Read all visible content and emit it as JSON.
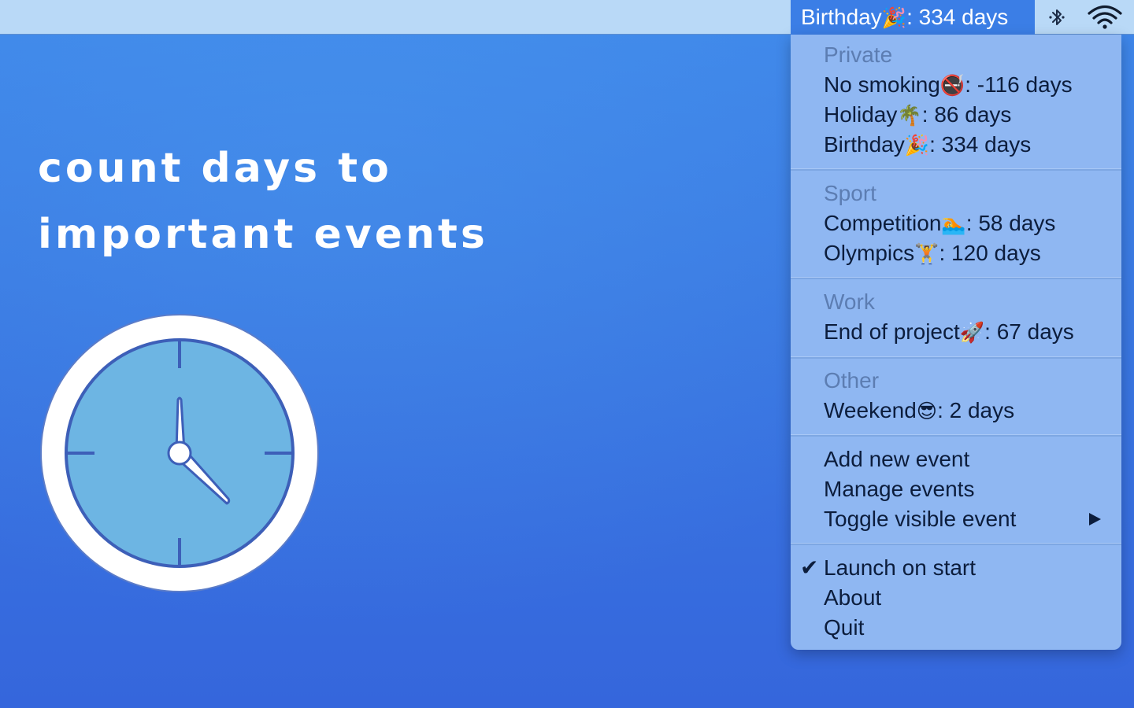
{
  "hero": {
    "line1": "count days to",
    "line2": "important events"
  },
  "menubar": {
    "status_label": "Birthday",
    "status_emoji": "🎉",
    "status_value": ": 334 days",
    "icons": [
      "bluetooth-icon",
      "wifi-icon"
    ]
  },
  "menu": {
    "groups": [
      {
        "header": "Private",
        "items": [
          {
            "name": "No smoking",
            "emoji": "🚭",
            "value": ": -116 days"
          },
          {
            "name": "Holiday",
            "emoji": "🌴",
            "value": ": 86 days"
          },
          {
            "name": "Birthday",
            "emoji": "🎉",
            "value": ": 334 days"
          }
        ]
      },
      {
        "header": "Sport",
        "items": [
          {
            "name": "Competition",
            "emoji": "🏊",
            "value": ": 58 days"
          },
          {
            "name": "Olympics",
            "emoji": "🏋",
            "value": ": 120 days"
          }
        ]
      },
      {
        "header": "Work",
        "items": [
          {
            "name": "End of project",
            "emoji": "🚀",
            "value": ": 67 days"
          }
        ]
      },
      {
        "header": "Other",
        "items": [
          {
            "name": "Weekend",
            "emoji": "😎",
            "value": ": 2 days"
          }
        ]
      }
    ],
    "actions": {
      "add": "Add new event",
      "manage": "Manage events",
      "toggle": "Toggle visible event"
    },
    "app": {
      "launch": "Launch on start",
      "launch_checked": true,
      "about": "About",
      "quit": "Quit"
    }
  },
  "colors": {
    "menubar_bg": "#b9d9f7",
    "status_highlight": "#3b7ee6",
    "menu_bg": "#8fb7f2",
    "header_text": "#5c7db2",
    "item_text": "#0c1d3c",
    "background_top": "#3f88ea",
    "background_bottom": "#3566dc",
    "clock_face": "#6db5e3",
    "clock_rim": "#ffffff",
    "clock_lines": "#3d5fb8"
  }
}
